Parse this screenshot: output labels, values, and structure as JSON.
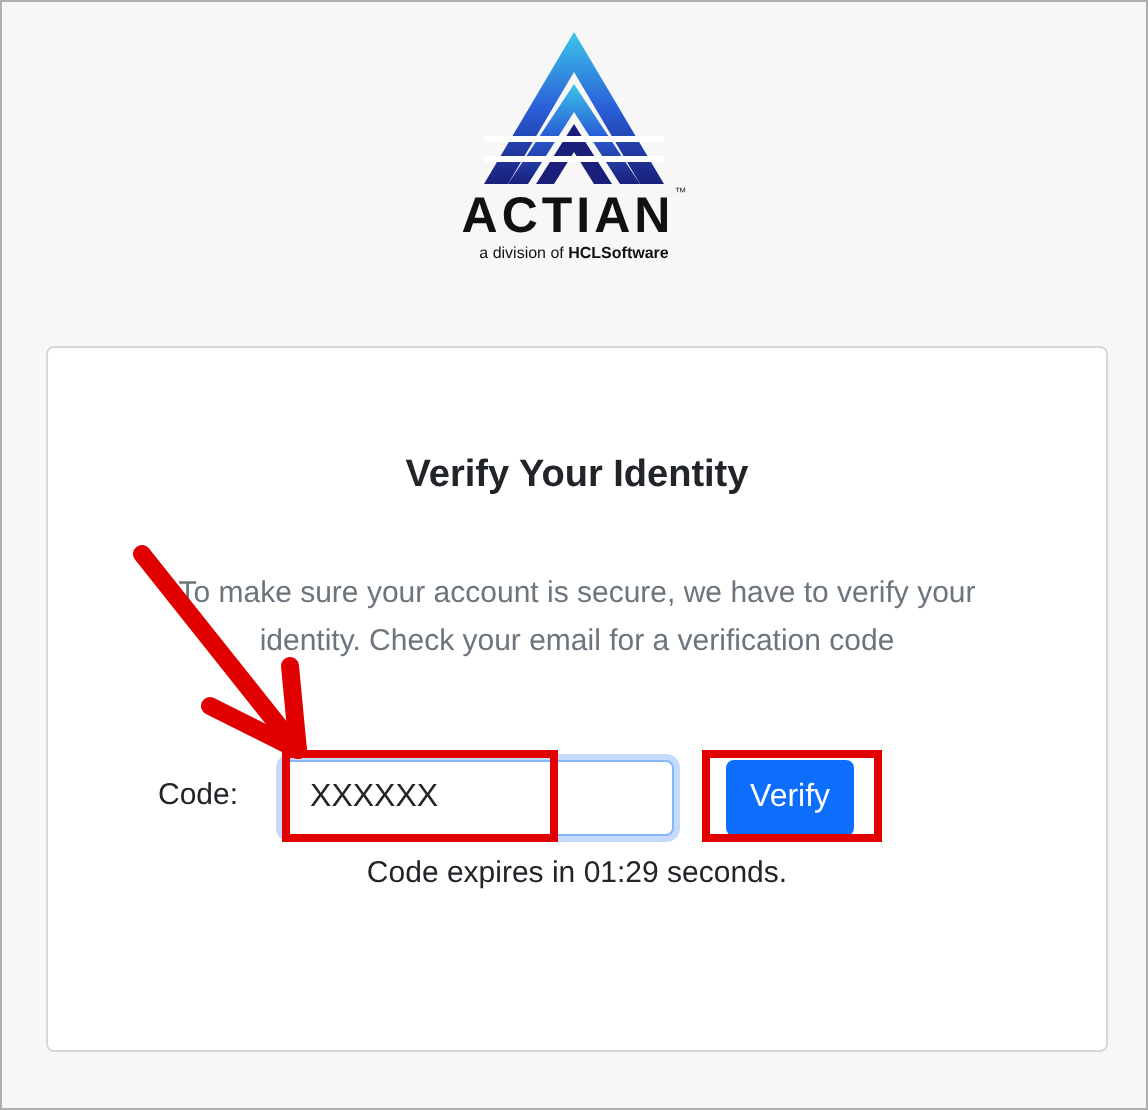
{
  "logo": {
    "wordmark": "ACTIAN",
    "trademark": "™",
    "tagline": "a division of **HCLSoftware**"
  },
  "card": {
    "title": "Verify Your Identity",
    "message": "To make sure your account is secure, we have to verify your identity. Check your email for a verification code",
    "code_field": {
      "label": "Code:",
      "value": "XXXXXX",
      "focused": true
    },
    "button": "Verify",
    "expiry": "Code expires in 01:29 seconds."
  },
  "annotations": [
    {
      "kind": "arrow"
    },
    {
      "kind": "field_frame"
    },
    {
      "kind": "button_frame"
    }
  ]
}
